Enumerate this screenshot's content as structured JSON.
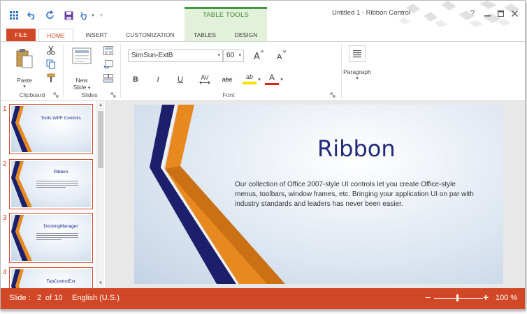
{
  "window": {
    "title": "Untitled 1 - Ribbon Control"
  },
  "quick_access": {
    "icons": [
      "app-menu-icon",
      "undo-icon",
      "redo-icon",
      "save-icon",
      "touch-mode-icon",
      "qat-dropdown-icon",
      "qat-customize-icon"
    ]
  },
  "contextual": {
    "label": "TABLE TOOLS"
  },
  "window_controls": {
    "help": "?"
  },
  "tabs": [
    "FILE",
    "HOME",
    "INSERT",
    "CUSTOMIZATION",
    "TABLES",
    "DESIGN"
  ],
  "ribbon": {
    "clipboard": {
      "paste_label": "Paste",
      "group_label": "Clipboard"
    },
    "slides": {
      "new_slide_line1": "New",
      "new_slide_line2": "Slide",
      "group_label": "Slides"
    },
    "font": {
      "font_name": "SimSun-ExtB",
      "font_size": "60",
      "group_label": "Font",
      "bold": "B",
      "italic": "I",
      "underline": "U",
      "spacing": "AV",
      "strike": "abc",
      "highlight": "ab",
      "font_color": "A"
    },
    "paragraph": {
      "label": "Paragraph"
    }
  },
  "slides": [
    {
      "num": "1",
      "title": "Tools WPF Controls"
    },
    {
      "num": "2",
      "title": "Ribbon"
    },
    {
      "num": "3",
      "title": "DockingManager"
    },
    {
      "num": "4",
      "title": "TabControlExt"
    }
  ],
  "current_slide": {
    "title": "Ribbon",
    "body": "Our collection of Office 2007-style UI  controls let you create Office-style menus, toolbars, window frames, etc. Bringing your application UI on par with industry standards and leaders has never been easier."
  },
  "status": {
    "slide_label": "Slide :",
    "slide_num": "2",
    "slide_of": "of 10",
    "language": "English (U.S.)",
    "zoom_minus": "−",
    "zoom_plus": "+",
    "zoom": "100 %"
  },
  "colors": {
    "accent": "#d24726",
    "contextual_green": "#3e9b3c",
    "slide_title": "#1f2a7c",
    "stripe_navy": "#1c1f6b",
    "stripe_orange": "#e8891f"
  }
}
